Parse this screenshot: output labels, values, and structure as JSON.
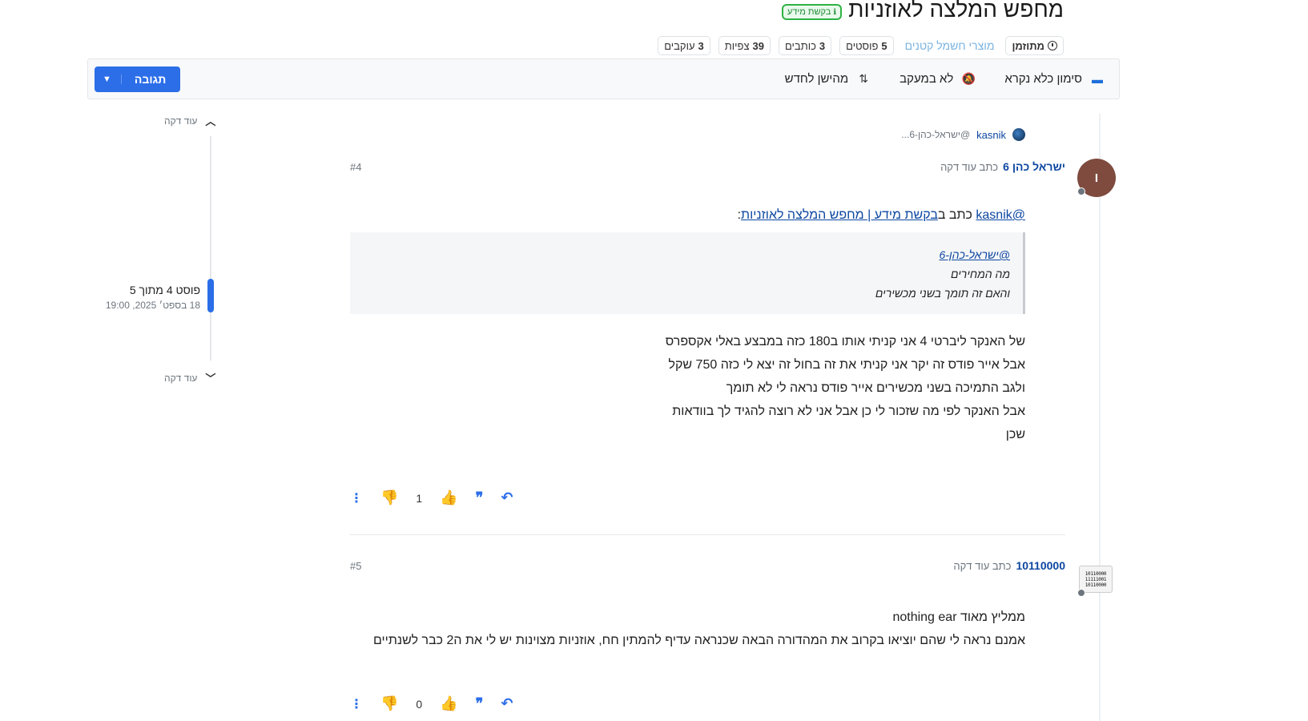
{
  "topic": {
    "title": "מחפש המלצה לאוזניות",
    "category_badge": "בקשת מידע",
    "category_badge_icon": "info-icon"
  },
  "stats": {
    "time_label": "מתוזמן",
    "category_link": "מוצרי חשמל קטנים",
    "posts": {
      "count": "5",
      "label": "פוסטים"
    },
    "writers": {
      "count": "3",
      "label": "כותבים"
    },
    "views": {
      "count": "39",
      "label": "צפיות"
    },
    "followers": {
      "count": "3",
      "label": "עוקבים"
    }
  },
  "toolbar": {
    "mark_read": "סימון כלא נקרא",
    "not_following": "לא במעקב",
    "sort": "מהישן לחדש",
    "reply": "תגובה"
  },
  "timeline": {
    "top_label": "עוד דקה",
    "bottom_label": "עוד דקה",
    "index": "פוסט 4 מתוך 5",
    "date": "18 בספט׳ 2025, 19:00"
  },
  "parent_ref": {
    "user": "kasnik",
    "mention": "@ישראל-כהן-6..."
  },
  "posts": [
    {
      "author": "ישראל כהן 6",
      "meta": "כתב עוד דקה",
      "number": "#4",
      "avatar_letter": "I",
      "quote_intro": {
        "mention": "@kasnik",
        "wrote_in": "כתב ב",
        "link": "בקשת מידע | מחפש המלצה לאוזניות",
        "colon": ":"
      },
      "quote": {
        "mention": "@ישראל-כהן-6",
        "line1": "מה המחירים",
        "line2": "והאם זה תומך בשני מכשירים"
      },
      "lines": [
        "של האנקר ליברטי 4 אני קניתי אותו ב180 כזה במבצע באלי אקספרס",
        "אבל אייר פודס זה יקר אני קניתי את זה בחול זה יצא לי כזה 750 שקל",
        "ולגב התמיכה בשני מכשירים אייר פודס נראה לי לא תומך",
        "אבל האנקר לפי מה שזכור לי כן אבל אני לא רוצה להגיד לך בוודאות",
        "שכן"
      ],
      "votes": "1"
    },
    {
      "author": "10110000",
      "meta": "כתב עוד דקה",
      "number": "#5",
      "avatar_lines": [
        "10110000",
        "11111001",
        "10110000"
      ],
      "lines": [
        "ממליץ מאוד nothing ear",
        "אמנם נראה לי שהם יוציאו בקרוב את המהדורה הבאה שכנראה עדיף להמתין חח, אוזניות מצוינות יש לי את ה2 כבר לשנתיים"
      ],
      "votes": "0"
    }
  ],
  "colors": {
    "accent": "#2b6ee8",
    "link": "#0d47a1",
    "badge_green": "#2fb344",
    "avatar_brown": "#7e4b3e"
  }
}
